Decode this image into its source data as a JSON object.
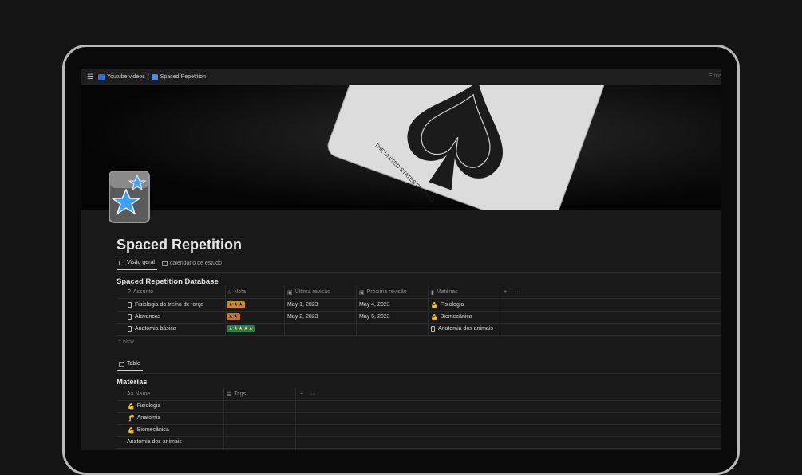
{
  "topbar": {
    "menu_icon": "hamburger-icon",
    "breadcrumb": [
      {
        "label": "Youtube videos",
        "icon": "youtube-icon",
        "color": "#2f6fd6"
      },
      {
        "label": "Spaced Repetition",
        "icon": "cards-icon",
        "color": "#4a8ee8"
      }
    ],
    "separator": "/",
    "right_text": "Edite"
  },
  "page": {
    "cover": "playing-card-ace-of-spades-photo",
    "icon": "anki-star-icon",
    "title": "Spaced Repetition",
    "tabs": [
      {
        "label": "Visão geral",
        "active": true
      },
      {
        "label": "calendário de estudo",
        "active": false
      }
    ]
  },
  "database": {
    "title": "Spaced Repetition Database",
    "columns": [
      "Assunto",
      "Nota",
      "Última revisão",
      "Próxima revisão",
      "Matérias"
    ],
    "add_symbol": "+",
    "more_symbol": "···",
    "rows": [
      {
        "assunto": "Fisiologia do treino de força",
        "nota": "★★★",
        "nota_color": "#c98a2e",
        "ultima": "May 1, 2023",
        "proxima": "May 4, 2023",
        "materia": "Fisiologia",
        "materia_icon": "💪"
      },
      {
        "assunto": "Alavancas",
        "nota": "★★",
        "nota_color": "#c8702d",
        "ultima": "May 2, 2023",
        "proxima": "May 5, 2023",
        "materia": "Biomecânica",
        "materia_icon": "💪"
      },
      {
        "assunto": "Anatomia básica",
        "nota": "★★★★★",
        "nota_color": "#2f7a55",
        "ultima": "",
        "proxima": "",
        "materia": "Anatomia dos animais",
        "materia_icon": "doc"
      }
    ],
    "new_label": "+ New"
  },
  "materias": {
    "view_tab": "Table",
    "title": "Matérias",
    "columns": [
      "Aa Name",
      "Tags"
    ],
    "add_symbol": "+",
    "more_symbol": "···",
    "rows": [
      {
        "name": "Fisiologia",
        "icon": "💪"
      },
      {
        "name": "Anatomia",
        "icon": "🦵"
      },
      {
        "name": "Biomecânica",
        "icon": "💪"
      },
      {
        "name": "Anatomia dos animais",
        "icon": ""
      }
    ]
  }
}
